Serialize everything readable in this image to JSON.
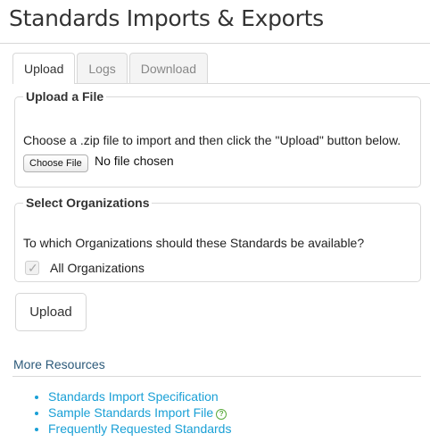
{
  "page_title": "Standards Imports & Exports",
  "tabs": [
    {
      "label": "Upload",
      "active": true
    },
    {
      "label": "Logs",
      "active": false
    },
    {
      "label": "Download",
      "active": false
    }
  ],
  "upload_section": {
    "legend": "Upload a File",
    "instructions": "Choose a .zip file to import and then click the \"Upload\" button below.",
    "choose_button_label": "Choose File",
    "file_status": "No file chosen"
  },
  "org_section": {
    "legend": "Select Organizations",
    "question": "To which Organizations should these Standards be available?",
    "checkbox_label": "All Organizations",
    "checkbox_checked": true,
    "checkbox_disabled": true
  },
  "upload_button_label": "Upload",
  "resources": {
    "heading": "More Resources",
    "links": [
      {
        "label": "Standards Import Specification",
        "help_icon": false
      },
      {
        "label": "Sample Standards Import File",
        "help_icon": true
      },
      {
        "label": "Frequently Requested Standards",
        "help_icon": false
      }
    ],
    "help_icon_glyph": "?",
    "link_color": "#1aa0d6"
  }
}
